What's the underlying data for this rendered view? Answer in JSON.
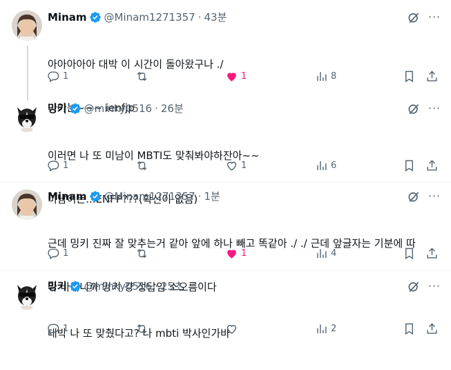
{
  "colors": {
    "accent": "#1d9bf0",
    "like": "#f91880",
    "muted": "#536471",
    "text": "#0f1419"
  },
  "tweets": [
    {
      "name": "Minam",
      "handle": "@Minam1271357",
      "time": "43분",
      "lines": [
        "아아아아아 대박 이 시간이 돌아왔구나 ./",
        "나아는~~~ ienfjp"
      ],
      "replies": "1",
      "retweets": "",
      "likes": "1",
      "liked": true,
      "views": "8",
      "avatar": "portrait-avatar"
    },
    {
      "name": "밍키",
      "handle": "@minky0516",
      "time": "26분",
      "lines": [
        "이러면 나 또 미남이 MBTI도 맞춰봐야하잔아~~",
        "미남이는...ENFP???(확신이 없음)"
      ],
      "replies": "1",
      "retweets": "",
      "likes": "1",
      "liked": false,
      "views": "6",
      "avatar": "dog-avatar"
    },
    {
      "name": "Minam",
      "handle": "@Minam1271357",
      "time": "1분",
      "lines": [
        "근데 밍키 진짜 잘 맞추는거 같아 앞에 하나 빼고 똑같아 ./ ./ 근데 앞글자는 기분에 따",
        "라 바뀌니까 밍키 걍 정답임 소오름이다"
      ],
      "replies": "1",
      "retweets": "",
      "likes": "1",
      "liked": true,
      "views": "4",
      "avatar": "portrait-avatar"
    },
    {
      "name": "밍키",
      "handle": "@minky0516",
      "time": "25초",
      "lines": [
        "대박 나 또 맞췄다고? 나 mbti 박사인가바"
      ],
      "replies": "1",
      "retweets": "",
      "likes": "",
      "liked": false,
      "views": "2",
      "avatar": "dog-avatar"
    }
  ]
}
